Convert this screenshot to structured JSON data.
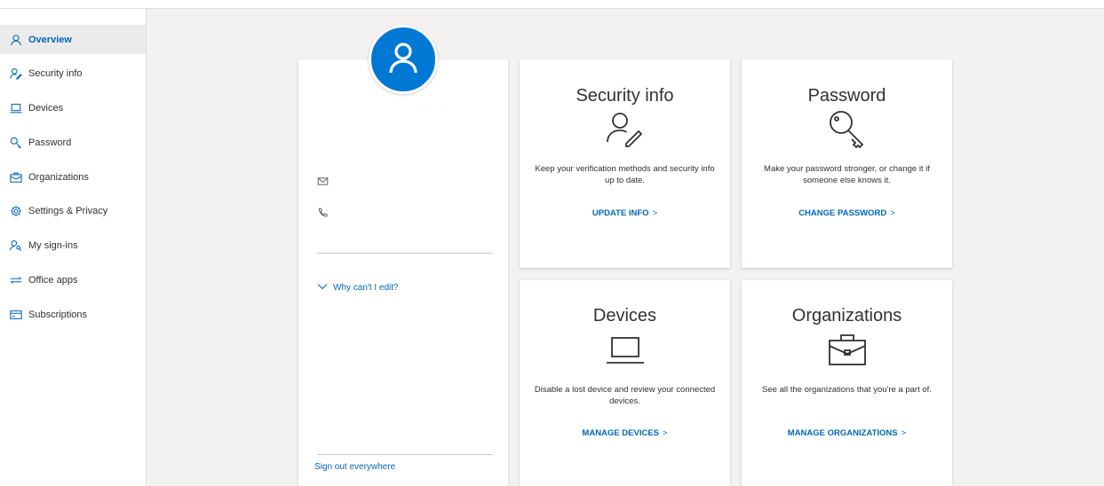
{
  "nav": {
    "items": [
      {
        "label": "Overview",
        "icon": "person-icon",
        "active": true
      },
      {
        "label": "Security info",
        "icon": "person-edit-icon"
      },
      {
        "label": "Devices",
        "icon": "laptop-icon"
      },
      {
        "label": "Password",
        "icon": "key-icon"
      },
      {
        "label": "Organizations",
        "icon": "briefcase-icon"
      },
      {
        "label": "Settings & Privacy",
        "icon": "gear-icon"
      },
      {
        "label": "My sign-ins",
        "icon": "person-key-icon"
      },
      {
        "label": "Office apps",
        "icon": "apps-icon"
      },
      {
        "label": "Subscriptions",
        "icon": "subscription-icon"
      }
    ]
  },
  "profile": {
    "why_edit": "Why can't I edit?",
    "sign_out": "Sign out everywhere"
  },
  "tiles": {
    "security": {
      "title": "Security info",
      "description": "Keep your verification methods and security info up to date.",
      "action": "UPDATE INFO",
      "chevron": ">"
    },
    "password": {
      "title": "Password",
      "description": "Make your password stronger, or change it if someone else knows it.",
      "action": "CHANGE PASSWORD",
      "chevron": ">"
    },
    "devices": {
      "title": "Devices",
      "description": "Disable a lost device and review your connected devices.",
      "action": "MANAGE DEVICES",
      "chevron": ">"
    },
    "organizations": {
      "title": "Organizations",
      "description": "See all the organizations that you're a part of.",
      "action": "MANAGE ORGANIZATIONS",
      "chevron": ">"
    }
  },
  "colors": {
    "accent": "#0067b8",
    "avatar_bg": "#0078d4",
    "page_bg": "#f3f2f1"
  }
}
